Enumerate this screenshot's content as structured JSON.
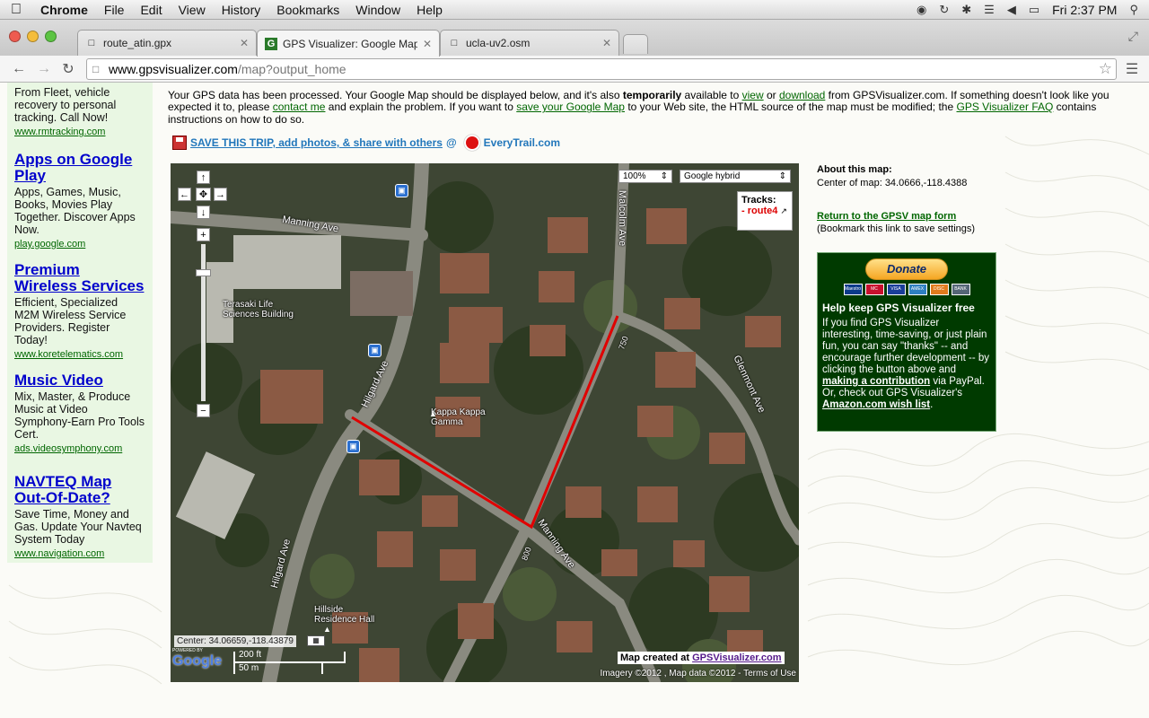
{
  "menubar": {
    "app": "Chrome",
    "items": [
      "File",
      "Edit",
      "View",
      "History",
      "Bookmarks",
      "Window",
      "Help"
    ],
    "clock": "Fri 2:37 PM"
  },
  "tabs": [
    {
      "title": "route_atin.gpx",
      "active": false
    },
    {
      "title": "GPS Visualizer: Google Maps",
      "active": true
    },
    {
      "title": "ucla-uv2.osm",
      "active": false
    }
  ],
  "address": {
    "host": "www.gpsvisualizer.com",
    "path": "/map?output_home"
  },
  "ads": {
    "top_fragment": {
      "body": "From Fleet, vehicle recovery to personal tracking. Call Now!",
      "url": "www.rmtracking.com"
    },
    "items": [
      {
        "title": "Apps on Google Play",
        "body": "Apps, Games, Music, Books, Movies Play Together. Discover Apps Now.",
        "url": "play.google.com"
      },
      {
        "title": "Premium Wireless Services",
        "body": "Efficient, Specialized M2M Wireless Service Providers. Register Today!",
        "url": "www.koretelematics.com"
      },
      {
        "title": "Music Video",
        "body": "Mix, Master, & Produce Music at Video Symphony-Earn Pro Tools Cert.",
        "url": "ads.videosymphony.com"
      },
      {
        "title": "NAVTEQ Map Out-Of-Date?",
        "body": "Save Time, Money and Gas. Update Your Navteq System Today",
        "url": "www.navigation.com"
      }
    ]
  },
  "intro": {
    "t1": "Your GPS data has been processed. Your Google Map should be displayed below, and it's also ",
    "t1b": "temporarily",
    "t2": " available to ",
    "view": "view",
    "t3": " or ",
    "download": "download",
    "t4": " from GPSVisualizer.com. If something doesn't look like you expected it to, please ",
    "contact": "contact me",
    "t5": " and explain the problem. If you want to ",
    "save": "save your Google Map",
    "t6": " to your Web site, the HTML source of the map must be modified; the ",
    "faq": "GPS Visualizer FAQ",
    "t7": " contains instructions on how to do so."
  },
  "savetrip": {
    "link": "SAVE THIS TRIP, add photos, & share with others",
    "at": "@",
    "brand": "EveryTrail.com"
  },
  "map": {
    "zoom": "100%",
    "maptype": "Google hybrid",
    "tracks_header": "Tracks:",
    "track_name": "route4",
    "streets": {
      "manning1": "Manning Ave",
      "manning2": "Manning Ave",
      "hilgard1": "Hilgard Ave",
      "hilgard2": "Hilgard Ave",
      "malcolm": "Malcolm Ave",
      "glenmont": "Glenmont Ave",
      "n750": "750",
      "n800": "800"
    },
    "places": {
      "terasaki": "Terasaki Life Sciences Building",
      "kappa": "Kappa Kappa Gamma",
      "hillside": "Hillside Residence Hall"
    },
    "center_readout": "Center: 34.06659,-118.43879",
    "created": "Map created at ",
    "created_link": "GPSVisualizer.com",
    "scale_ft": "200 ft",
    "scale_m": "50 m",
    "attribution": "Imagery ©2012 , Map data ©2012 - Terms of Use",
    "powered": "POWERED BY",
    "google": "Google"
  },
  "about": {
    "heading": "About this map:",
    "center": "Center of map: 34.0666,-118.4388",
    "return_link": "Return to the GPSV map form",
    "return_note": "(Bookmark this link to save settings)"
  },
  "donate": {
    "button": "Donate",
    "cards": [
      "Maestro",
      "MC",
      "VISA",
      "AMEX",
      "DISC",
      "BANK"
    ],
    "heading": "Help keep GPS Visualizer free",
    "p1": "If you find GPS Visualizer interesting, time-saving, or just plain fun, you can say \"thanks\" -- and encourage further development -- by clicking the button above and ",
    "p1link": "making a contribution",
    "p2": " via PayPal. Or, check out GPS Visualizer's ",
    "p2link": "Amazon.com wish list",
    "p3": "."
  },
  "colors": {
    "track": "#e00000",
    "ad_bg": "#e9f7e3",
    "donate_bg": "#003a00",
    "link_green": "#006600"
  }
}
